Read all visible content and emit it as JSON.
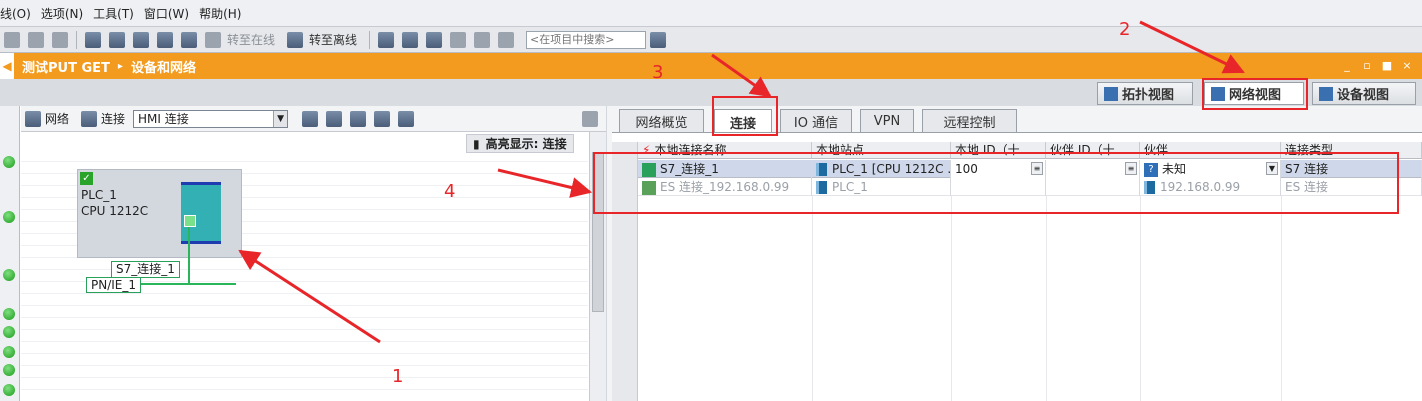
{
  "menu": [
    "线(O)",
    "选项(N)",
    "工具(T)",
    "窗口(W)",
    "帮助(H)"
  ],
  "toolbar": {
    "go_online": "转至在线",
    "go_offline": "转至离线",
    "search_placeholder": "<在项目中搜索>"
  },
  "titlebar": {
    "project": "测试PUT GET",
    "separator": "▸",
    "section": "设备和网络",
    "window_controls": [
      "_",
      "▫",
      "■",
      "×"
    ]
  },
  "view_tabs": [
    "拓扑视图",
    "网络视图",
    "设备视图"
  ],
  "left": {
    "network_btn": "网络",
    "connect_btn": "连接",
    "connection_type": "HMI 连接",
    "highlight_label": "高亮显示: 连接",
    "plc_name": "PLC_1",
    "plc_cpu": "CPU 1212C",
    "connection_label": "S7_连接_1",
    "subnet_label": "PN/IE_1"
  },
  "right_tabs": [
    "网络概览",
    "连接",
    "IO 通信",
    "VPN",
    "远程控制"
  ],
  "table": {
    "headers": [
      "本地连接名称",
      "本地站点",
      "本地 ID（十",
      "伙伴 ID（十",
      "伙伴",
      "连接类型"
    ],
    "rows": [
      {
        "name": "S7_连接_1",
        "station": "PLC_1 [CPU 1212C ...",
        "local_id": "100",
        "partner_id": "",
        "partner": "未知",
        "type": "S7 连接"
      },
      {
        "name": "ES 连接_192.168.0.99",
        "station": "PLC_1",
        "local_id": "",
        "partner_id": "",
        "partner": "192.168.0.99",
        "type": "ES 连接"
      }
    ]
  },
  "annotations": [
    "1",
    "2",
    "3",
    "4"
  ],
  "colors": {
    "title_orange": "#f29b1e",
    "annotation_red": "#e8262a",
    "status_green": "#1b9a1b"
  }
}
